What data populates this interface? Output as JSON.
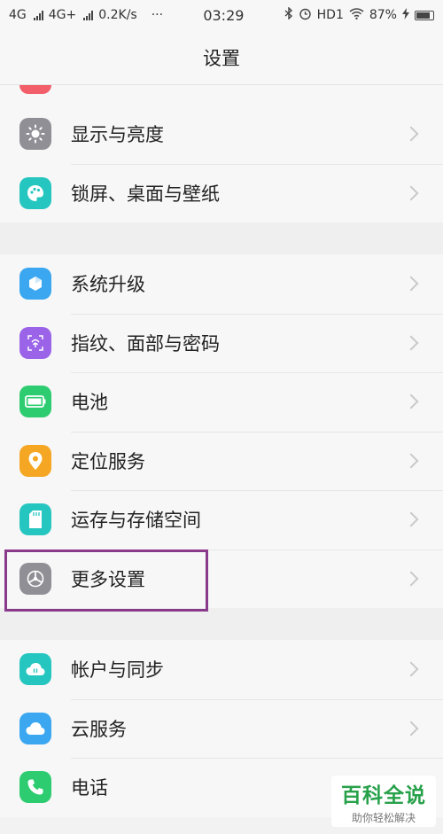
{
  "status_bar": {
    "network_1": "4G",
    "network_2": "4G+",
    "speed": "0.2K/s",
    "dots": "···",
    "time": "03:29",
    "hd": "HD1",
    "battery": "87%"
  },
  "header": {
    "title": "设置"
  },
  "groups": [
    {
      "items": [
        {
          "label": "显示与亮度",
          "icon": "sun-icon",
          "color": "#8f8f95"
        },
        {
          "label": "锁屏、桌面与壁纸",
          "icon": "palette-icon",
          "color": "#26c6c0"
        }
      ]
    },
    {
      "items": [
        {
          "label": "系统升级",
          "icon": "upgrade-icon",
          "color": "#3aa7f0"
        },
        {
          "label": "指纹、面部与密码",
          "icon": "fingerprint-icon",
          "color": "#9a63e8"
        },
        {
          "label": "电池",
          "icon": "battery-icon",
          "color": "#2ecc71"
        },
        {
          "label": "定位服务",
          "icon": "location-icon",
          "color": "#f5a623"
        },
        {
          "label": "运存与存储空间",
          "icon": "storage-icon",
          "color": "#26c6c0"
        },
        {
          "label": "更多设置",
          "icon": "settings-icon",
          "color": "#8f8f95"
        }
      ]
    },
    {
      "items": [
        {
          "label": "帐户与同步",
          "icon": "cloud-sync-icon",
          "color": "#26c6c0"
        },
        {
          "label": "云服务",
          "icon": "cloud-icon",
          "color": "#3aa7f0"
        },
        {
          "label": "电话",
          "icon": "phone-icon",
          "color": "#2ecc71"
        }
      ]
    }
  ],
  "watermark": {
    "title": "百科全说",
    "subtitle": "助你轻松解决"
  },
  "colors": {
    "highlight": "#8a3a8a",
    "top_partial": "#f25f6b"
  }
}
